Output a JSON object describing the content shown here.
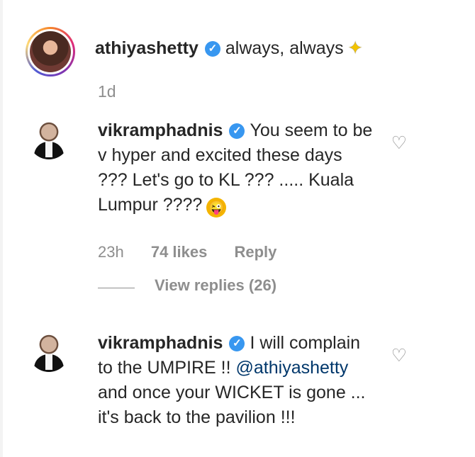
{
  "post": {
    "username": "athiyashetty",
    "text": "always, always",
    "timestamp": "1d",
    "sparkle_icon": "sparkles-icon"
  },
  "replies": [
    {
      "username": "vikramphadnis",
      "lines": [
        "You seem to be",
        "v hyper and excited these days",
        "??? Let's go to KL ??? ..... Kuala",
        "Lumpur ????"
      ],
      "timestamp": "23h",
      "likes": "74 likes",
      "reply_label": "Reply",
      "view_replies": "View replies (26)",
      "emoji": "tongue-wink-emoji"
    },
    {
      "username": "vikramphadnis",
      "lines": [
        "I will complain",
        "to the UMPIRE !! ",
        "and once your WICKET is gone ...",
        "it's back to the pavilion !!!"
      ],
      "mention": "@athiyashetty"
    }
  ],
  "colors": {
    "text": "#262626",
    "muted": "#8e8e8e",
    "verified": "#3897f0",
    "mention": "#00376b"
  }
}
